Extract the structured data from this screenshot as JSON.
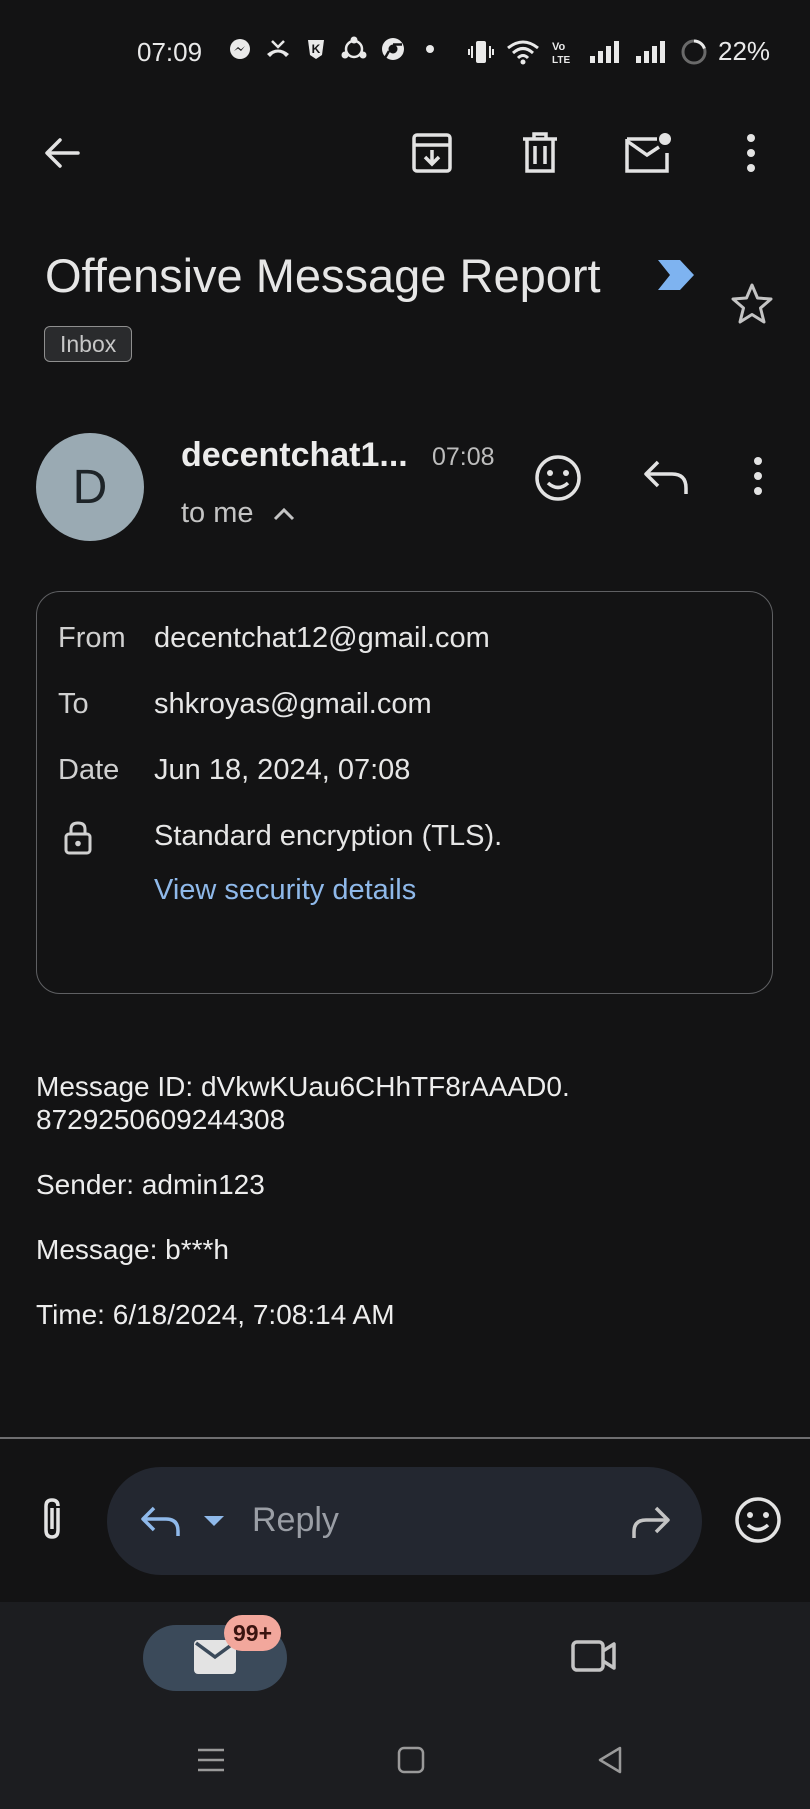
{
  "status_bar": {
    "time": "07:09",
    "battery": "22%",
    "icons": [
      "messenger-icon",
      "missed-call-icon",
      "k-app-icon",
      "share-app-icon",
      "chrome-icon",
      "dot-icon",
      "vibrate-icon",
      "wifi-icon",
      "volte-icon",
      "signal-icon",
      "signal-icon",
      "battery-icon"
    ],
    "volte_text": "Vo LTE"
  },
  "toolbar": {
    "icons": [
      "back-arrow-icon",
      "archive-icon",
      "delete-icon",
      "mark-unread-icon",
      "more-vert-icon"
    ]
  },
  "email": {
    "subject": "Offensive Message Report",
    "label_chip": "Inbox",
    "label_color": "#7eb3f0",
    "sender_initial": "D",
    "sender_name": "decentchat1...",
    "time": "07:08",
    "to_me": "to me"
  },
  "details": {
    "from_label": "From",
    "from_value": "decentchat12@gmail.com",
    "to_label": "To",
    "to_value": "shkroyas@gmail.com",
    "date_label": "Date",
    "date_value": "Jun 18, 2024, 07:08",
    "encryption": "Standard encryption (TLS).",
    "security_link": "View security details"
  },
  "body": {
    "line1": "Message ID: dVkwKUau6CHhTF8rAAAD0.",
    "line2": "8729250609244308",
    "sender": "Sender: admin123",
    "message": "Message: b***h",
    "time": "Time: 6/18/2024, 7:08:14 AM"
  },
  "reply_bar": {
    "placeholder": "Reply"
  },
  "bottom_nav": {
    "mail_badge": "99+"
  },
  "colors": {
    "background": "#131314",
    "link": "#8fb9ea",
    "badge": "#f2a79c",
    "mail_pill": "#3b4a5a"
  }
}
